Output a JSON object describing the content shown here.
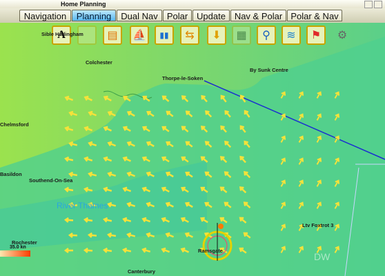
{
  "window": {
    "title": "Home Planning"
  },
  "tabs": [
    {
      "label": "Navigation",
      "active": false
    },
    {
      "label": "Planning",
      "active": true
    },
    {
      "label": "Dual Nav",
      "active": false
    },
    {
      "label": "Polar",
      "active": false
    },
    {
      "label": "Update",
      "active": false
    },
    {
      "label": "Nav & Polar",
      "active": false
    },
    {
      "label": "Polar & Nav",
      "active": false
    }
  ],
  "toolbar": {
    "items": [
      {
        "icon": "text-annotation-icon",
        "glyph": "A"
      },
      {
        "icon": "blank-layer-icon",
        "glyph": ""
      },
      {
        "icon": "terrain-layer-icon",
        "glyph": "▤"
      },
      {
        "icon": "sail-icon",
        "glyph": "⛵"
      },
      {
        "icon": "tide-gauge-icon",
        "glyph": "▮▮"
      },
      {
        "icon": "current-arrows-icon",
        "glyph": "⇆"
      },
      {
        "icon": "download-weather-icon",
        "glyph": "⬇"
      },
      {
        "icon": "grid-icon",
        "glyph": "▦"
      },
      {
        "icon": "route-network-icon",
        "glyph": "⚲"
      },
      {
        "icon": "wind-lines-icon",
        "glyph": "≋"
      },
      {
        "icon": "windsock-icon",
        "glyph": "⚑"
      },
      {
        "icon": "settings-icon",
        "glyph": "⚙"
      }
    ]
  },
  "places": [
    {
      "name": "Colchester"
    },
    {
      "name": "Thorpe-le-Soken"
    },
    {
      "name": "By Sunk Centre"
    },
    {
      "name": "Chelmsford"
    },
    {
      "name": "Basildon"
    },
    {
      "name": "Southend-On-Sea"
    },
    {
      "name": "Rochester"
    },
    {
      "name": "Ramsgate"
    },
    {
      "name": "Canterbury"
    },
    {
      "name": "Ltv Foxtrot 3"
    },
    {
      "name": "Sible Hedingham"
    }
  ],
  "river_label": "River Thames",
  "scale": {
    "label": "35.0 kn"
  },
  "watermark": "DW",
  "colors": {
    "sea": "#5bd089",
    "land": "#9be24e",
    "arrow": "#f5e23a",
    "route": "#1b2fd0",
    "active_tab": "#58b8f0"
  }
}
